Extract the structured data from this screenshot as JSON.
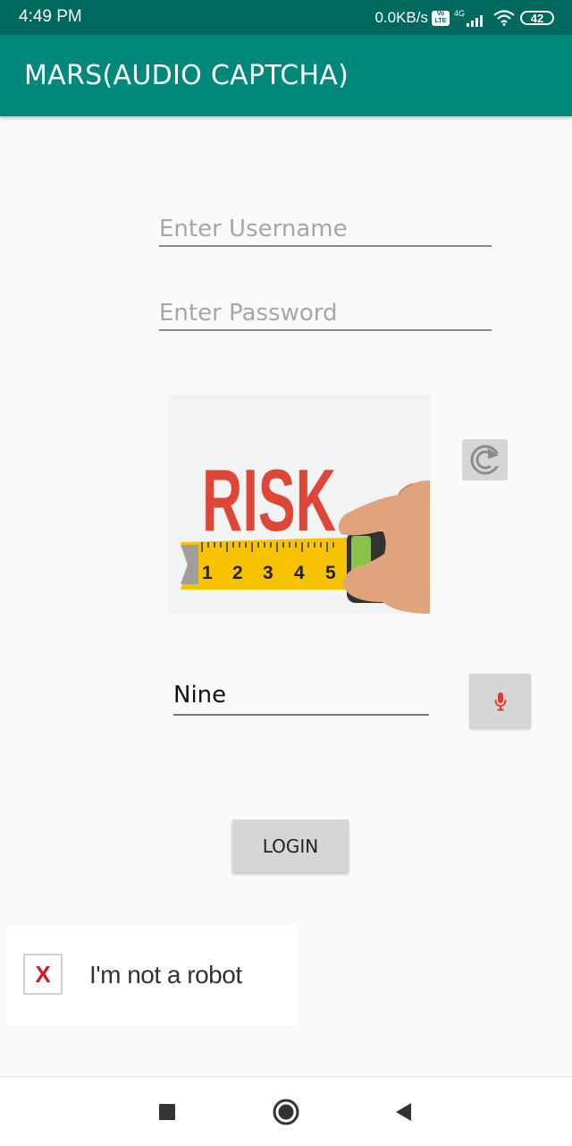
{
  "status_bar": {
    "time": "4:49 PM",
    "net_speed": "0.0KB/s",
    "volte_label": "Vo LTE",
    "network_type": "4G",
    "battery": "42"
  },
  "app_bar": {
    "title": "MARS(AUDIO CAPTCHA)"
  },
  "form": {
    "username_placeholder": "Enter Username",
    "username_value": "",
    "password_placeholder": "Enter Password",
    "password_value": ""
  },
  "captcha": {
    "image_word": "RISK",
    "tape_numbers": [
      "1",
      "2",
      "3",
      "4",
      "5"
    ],
    "answer_value": "Nine"
  },
  "login_label": "LOGIN",
  "recaptcha": {
    "mark": "X",
    "label": "I'm not a robot"
  },
  "colors": {
    "status_bar": "#00695f",
    "app_bar": "#00897b",
    "risk_text": "#de4638",
    "tape": "#f7c200",
    "hand": "#e0a47d",
    "mic": "#e53935",
    "robot_mark": "#e0161e"
  },
  "icons": {
    "refresh": "refresh-icon",
    "mic": "mic-icon",
    "nav_recents": "square-icon",
    "nav_home": "circle-icon",
    "nav_back": "triangle-back-icon"
  }
}
